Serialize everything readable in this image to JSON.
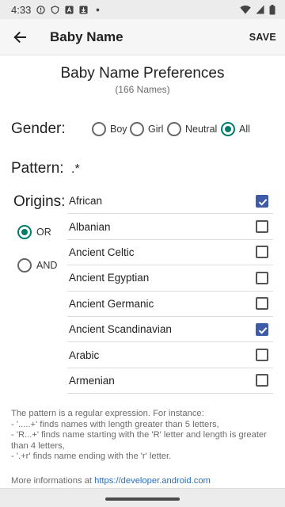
{
  "status_bar": {
    "time": "4:33",
    "icons_left": [
      "warning-circle-icon",
      "shield-icon",
      "font-a-icon",
      "download-icon",
      "dot-icon"
    ],
    "icons_right": [
      "wifi-icon",
      "signal-icon",
      "battery-icon"
    ]
  },
  "app_bar": {
    "title": "Baby Name",
    "save_label": "SAVE",
    "back_icon": "arrow-back-icon"
  },
  "header": {
    "title": "Baby Name Preferences",
    "count": "(166 Names)"
  },
  "gender": {
    "label": "Gender:",
    "options": [
      {
        "label": "Boy",
        "selected": false
      },
      {
        "label": "Girl",
        "selected": false
      },
      {
        "label": "Neutral",
        "selected": false
      },
      {
        "label": "All",
        "selected": true
      }
    ]
  },
  "pattern": {
    "label": "Pattern:",
    "value": ".*"
  },
  "origins": {
    "label": "Origins:",
    "modes": [
      {
        "label": "OR",
        "selected": true
      },
      {
        "label": "AND",
        "selected": false
      }
    ],
    "items": [
      {
        "name": "African",
        "checked": true
      },
      {
        "name": "Albanian",
        "checked": false
      },
      {
        "name": "Ancient Celtic",
        "checked": false
      },
      {
        "name": "Ancient Egyptian",
        "checked": false
      },
      {
        "name": "Ancient Germanic",
        "checked": false
      },
      {
        "name": "Ancient Scandinavian",
        "checked": true
      },
      {
        "name": "Arabic",
        "checked": false
      },
      {
        "name": "Armenian",
        "checked": false
      }
    ]
  },
  "help": {
    "text": "The pattern is a regular expression. For instance:\n - '.....+' finds names with length greater than 5 letters,\n - 'R...+' finds name starting with the 'R' letter and length is greater than 4 letters,\n - '.+r' finds name ending with the 'r' letter.",
    "more_prefix": "More informations at ",
    "more_link": "https://developer.android.com"
  },
  "colors": {
    "radio_accent": "#007c6a",
    "checkbox_accent": "#3f5aa8",
    "link": "#2a6ec0"
  }
}
